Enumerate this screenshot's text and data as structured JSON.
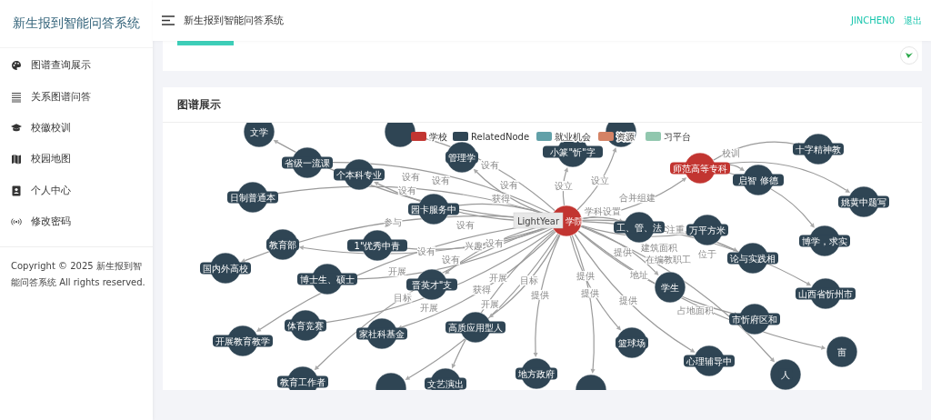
{
  "sidebar": {
    "title": "新生报到智能问答系统",
    "items": [
      {
        "label": "图谱查询展示",
        "selected": false
      },
      {
        "label": "关系图谱问答",
        "selected": false
      },
      {
        "label": "校徽校训",
        "selected": false
      },
      {
        "label": "校园地图",
        "selected": false
      },
      {
        "label": "个人中心",
        "selected": false
      },
      {
        "label": "修改密码",
        "selected": false
      }
    ],
    "copyright": "Copyright © 2025 新生报到智能问答系统 All rights reserved."
  },
  "header": {
    "title": "新生报到智能问答系统",
    "user": "JINCHEN0",
    "logout": "退出"
  },
  "graph_card": {
    "title": "图谱展示",
    "legend": [
      {
        "label": "学校",
        "color": "#c23531"
      },
      {
        "label": "RelatedNode",
        "color": "#2f4554"
      },
      {
        "label": "就业机会",
        "color": "#61a0a8"
      },
      {
        "label": "资源",
        "color": "#d48265"
      },
      {
        "label": "习平台",
        "color": "#91c7ae"
      }
    ],
    "tooltip": "LightYear",
    "center": {
      "label": "学院",
      "kind": "school",
      "children": [
        {
          "label": "文学",
          "kind": "node",
          "edge_label": "设有"
        },
        {
          "label": "省级一流课",
          "kind": "node",
          "edge_label": "设有"
        },
        {
          "label": "个本科专业",
          "kind": "node",
          "edge_label": "设有"
        },
        {
          "label": "日制普通本",
          "kind": "node",
          "edge_label": "设有"
        },
        {
          "label": "教育部",
          "kind": "node",
          "edge_label": "设有"
        },
        {
          "label": "园卡服务中",
          "kind": "node",
          "edge_label": "获得"
        },
        {
          "label": "1\"优秀中青",
          "kind": "node",
          "edge_label": "兴趣"
        },
        {
          "label": "国内外高校",
          "kind": "node",
          "edge_label": "参与"
        },
        {
          "label": "博士生、硕士",
          "kind": "node",
          "edge_label": "设有"
        },
        {
          "label": "晋英才\"支",
          "kind": "node",
          "edge_label": "设有"
        },
        {
          "label": "体育竞赛",
          "kind": "node",
          "edge_label": "开展"
        },
        {
          "label": "开展教育教学",
          "kind": "node",
          "edge_label": "开展"
        },
        {
          "label": "家社科基金",
          "kind": "node",
          "edge_label": "获得"
        },
        {
          "label": "教育工作者",
          "kind": "node",
          "edge_label": "目标"
        },
        {
          "kind": "node",
          "edge_label": "开展"
        },
        {
          "label": "文艺演出",
          "kind": "node",
          "edge_label": "开展"
        },
        {
          "label": "高质应用型人",
          "kind": "node",
          "edge_label": "目标"
        },
        {
          "label": "地方政府",
          "kind": "node",
          "edge_label": "提供"
        },
        {
          "kind": "node",
          "edge_label": "提供"
        },
        {
          "label": "篮球场",
          "kind": "node",
          "edge_label": "提供"
        },
        {
          "label": "学生",
          "kind": "node",
          "edge_label": "提供"
        },
        {
          "label": "心理辅导中",
          "kind": "node",
          "edge_label": "提供"
        },
        {
          "label": "管理学",
          "kind": "node",
          "edge_label": "设有"
        },
        {
          "kind": "node",
          "edge_label": "设有"
        },
        {
          "label": "小篆\"忻\"字",
          "kind": "node",
          "edge_label": "设立"
        },
        {
          "kind": "node",
          "edge_label": "设立"
        },
        {
          "label": "工、管、法",
          "kind": "node",
          "edge_label": "学科设置"
        },
        {
          "label": "万平方米",
          "kind": "node",
          "edge_label": "建筑面积"
        },
        {
          "label": "论与实践相",
          "kind": "node",
          "edge_label": "注重"
        },
        {
          "label": "市忻府区和",
          "kind": "node",
          "edge_label": "地址"
        },
        {
          "label": "山西省忻州市",
          "kind": "node",
          "edge_label": "位于"
        },
        {
          "label": "亩",
          "kind": "node",
          "edge_label": "占地面积"
        },
        {
          "label": "人",
          "kind": "node",
          "edge_label": "在编教职工"
        },
        {
          "label": "师范高等专科",
          "kind": "school",
          "edge_label": "合并组建",
          "children": [
            {
              "label": "启智 修德",
              "kind": "node",
              "edge_label": "校训"
            },
            {
              "label": "十字精神教",
              "kind": "node"
            },
            {
              "label": "姚黄中题写",
              "kind": "node"
            },
            {
              "label": "博学，求实",
              "kind": "node"
            }
          ]
        }
      ]
    }
  }
}
